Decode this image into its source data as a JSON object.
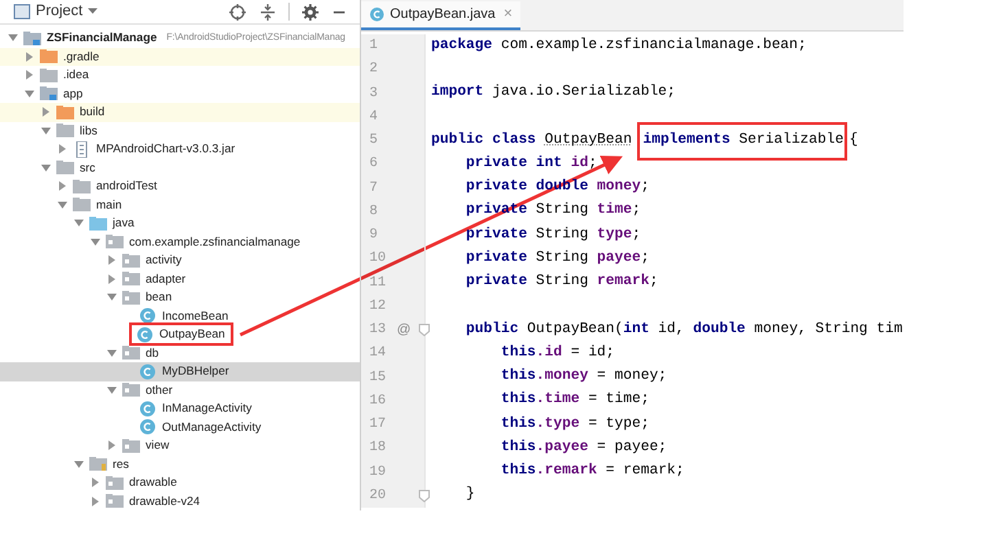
{
  "project_panel": {
    "title": "Project",
    "tree": [
      {
        "label": "ZSFinancialManage",
        "path": "F:\\AndroidStudioProject\\ZSFinancialManag",
        "kind": "module",
        "expanded": true,
        "selected": false,
        "children": [
          {
            "label": ".gradle",
            "kind": "excluded-folder",
            "expanded": false,
            "selected": false
          },
          {
            "label": ".idea",
            "kind": "folder",
            "expanded": false,
            "selected": false
          },
          {
            "label": "app",
            "kind": "module",
            "expanded": true,
            "selected": false,
            "children": [
              {
                "label": "build",
                "kind": "excluded-folder",
                "expanded": false,
                "selected": false
              },
              {
                "label": "libs",
                "kind": "folder",
                "expanded": true,
                "selected": false,
                "children": [
                  {
                    "label": "MPAndroidChart-v3.0.3.jar",
                    "kind": "jar",
                    "expanded": false,
                    "selected": false
                  }
                ]
              },
              {
                "label": "src",
                "kind": "folder",
                "expanded": true,
                "selected": false,
                "children": [
                  {
                    "label": "androidTest",
                    "kind": "folder",
                    "expanded": false,
                    "selected": false
                  },
                  {
                    "label": "main",
                    "kind": "folder",
                    "expanded": true,
                    "selected": false,
                    "children": [
                      {
                        "label": "java",
                        "kind": "source-folder",
                        "expanded": true,
                        "selected": false,
                        "children": [
                          {
                            "label": "com.example.zsfinancialmanage",
                            "kind": "package",
                            "expanded": true,
                            "selected": false,
                            "children": [
                              {
                                "label": "activity",
                                "kind": "package",
                                "expanded": false,
                                "selected": false
                              },
                              {
                                "label": "adapter",
                                "kind": "package",
                                "expanded": false,
                                "selected": false
                              },
                              {
                                "label": "bean",
                                "kind": "package",
                                "expanded": true,
                                "selected": false,
                                "children": [
                                  {
                                    "label": "IncomeBean",
                                    "kind": "class",
                                    "selected": false
                                  },
                                  {
                                    "label": "OutpayBean",
                                    "kind": "class",
                                    "selected": false,
                                    "annotated": true
                                  }
                                ]
                              },
                              {
                                "label": "db",
                                "kind": "package",
                                "expanded": true,
                                "selected": false,
                                "children": [
                                  {
                                    "label": "MyDBHelper",
                                    "kind": "class",
                                    "selected": true
                                  }
                                ]
                              },
                              {
                                "label": "other",
                                "kind": "package",
                                "expanded": true,
                                "selected": false,
                                "children": [
                                  {
                                    "label": "InManageActivity",
                                    "kind": "class",
                                    "selected": false
                                  },
                                  {
                                    "label": "OutManageActivity",
                                    "kind": "class",
                                    "selected": false
                                  }
                                ]
                              },
                              {
                                "label": "view",
                                "kind": "package",
                                "expanded": false,
                                "selected": false
                              }
                            ]
                          }
                        ]
                      },
                      {
                        "label": "res",
                        "kind": "resources",
                        "expanded": true,
                        "selected": false,
                        "children": [
                          {
                            "label": "drawable",
                            "kind": "package",
                            "expanded": false,
                            "selected": false
                          },
                          {
                            "label": "drawable-v24",
                            "kind": "package",
                            "expanded": false,
                            "selected": false
                          }
                        ]
                      }
                    ]
                  }
                ]
              }
            ]
          }
        ]
      }
    ]
  },
  "editor": {
    "tab": {
      "label": "OutpayBean.java",
      "close": "×",
      "selected": true
    },
    "lines": [
      {
        "number": "1",
        "tokens": [
          {
            "text": "package",
            "kind": "keyword"
          },
          {
            "text": " com.example.zsfinancialmanage.bean;",
            "kind": "plain"
          }
        ]
      },
      {
        "number": "2"
      },
      {
        "number": "3",
        "tokens": [
          {
            "text": "import",
            "kind": "keyword"
          },
          {
            "text": " java.io.Serializable;",
            "kind": "plain"
          }
        ]
      },
      {
        "number": "4"
      },
      {
        "number": "5",
        "tokens": [
          {
            "text": "public class ",
            "kind": "keyword"
          },
          {
            "text": "OutpayBean",
            "kind": "underlined"
          },
          {
            "text": "implements",
            "kind": "keyword",
            "annotated": true
          },
          {
            "text": " Serializable",
            "kind": "plain",
            "annotated": true
          },
          {
            "text": "{",
            "kind": "plain"
          }
        ]
      },
      {
        "number": "6",
        "tokens": [
          {
            "text": "    private int",
            "kind": "keyword"
          },
          {
            "text": " id",
            "kind": "field"
          },
          {
            "text": ";",
            "kind": "plain"
          }
        ]
      },
      {
        "number": "7",
        "tokens": [
          {
            "text": "    private double",
            "kind": "keyword"
          },
          {
            "text": " money",
            "kind": "field"
          },
          {
            "text": ";",
            "kind": "plain"
          }
        ]
      },
      {
        "number": "8",
        "tokens": [
          {
            "text": "    private",
            "kind": "keyword"
          },
          {
            "text": " String ",
            "kind": "plain"
          },
          {
            "text": "time",
            "kind": "field"
          },
          {
            "text": ";",
            "kind": "plain"
          }
        ]
      },
      {
        "number": "9",
        "tokens": [
          {
            "text": "    private",
            "kind": "keyword"
          },
          {
            "text": " String ",
            "kind": "plain"
          },
          {
            "text": "type",
            "kind": "field"
          },
          {
            "text": ";",
            "kind": "plain"
          }
        ]
      },
      {
        "number": "10",
        "tokens": [
          {
            "text": "    private",
            "kind": "keyword"
          },
          {
            "text": " String ",
            "kind": "plain"
          },
          {
            "text": "payee",
            "kind": "field"
          },
          {
            "text": ";",
            "kind": "plain"
          }
        ]
      },
      {
        "number": "11",
        "tokens": [
          {
            "text": "    private",
            "kind": "keyword"
          },
          {
            "text": " String ",
            "kind": "plain"
          },
          {
            "text": "remark",
            "kind": "field"
          },
          {
            "text": ";",
            "kind": "plain"
          }
        ]
      },
      {
        "number": "12"
      },
      {
        "number": "13",
        "marker": "@",
        "fold": true,
        "tokens": [
          {
            "text": "    public",
            "kind": "keyword"
          },
          {
            "text": " OutpayBean(",
            "kind": "plain"
          },
          {
            "text": "int",
            "kind": "keyword"
          },
          {
            "text": " id, ",
            "kind": "plain"
          },
          {
            "text": "double",
            "kind": "keyword"
          },
          {
            "text": " money, String tim",
            "kind": "plain"
          }
        ]
      },
      {
        "number": "14",
        "tokens": [
          {
            "text": "        this",
            "kind": "keyword"
          },
          {
            "text": ".id",
            "kind": "field"
          },
          {
            "text": " = id;",
            "kind": "plain"
          }
        ]
      },
      {
        "number": "15",
        "tokens": [
          {
            "text": "        this",
            "kind": "keyword"
          },
          {
            "text": ".money",
            "kind": "field"
          },
          {
            "text": " = money;",
            "kind": "plain"
          }
        ]
      },
      {
        "number": "16",
        "tokens": [
          {
            "text": "        this",
            "kind": "keyword"
          },
          {
            "text": ".time",
            "kind": "field"
          },
          {
            "text": " = time;",
            "kind": "plain"
          }
        ]
      },
      {
        "number": "17",
        "tokens": [
          {
            "text": "        this",
            "kind": "keyword"
          },
          {
            "text": ".type",
            "kind": "field"
          },
          {
            "text": " = type;",
            "kind": "plain"
          }
        ]
      },
      {
        "number": "18",
        "tokens": [
          {
            "text": "        this",
            "kind": "keyword"
          },
          {
            "text": ".payee",
            "kind": "field"
          },
          {
            "text": " = payee;",
            "kind": "plain"
          }
        ]
      },
      {
        "number": "19",
        "tokens": [
          {
            "text": "        this",
            "kind": "keyword"
          },
          {
            "text": ".remark",
            "kind": "field"
          },
          {
            "text": " = remark;",
            "kind": "plain"
          }
        ]
      },
      {
        "number": "20",
        "fold": true,
        "tokens": [
          {
            "text": "    }",
            "kind": "plain"
          }
        ]
      }
    ]
  }
}
